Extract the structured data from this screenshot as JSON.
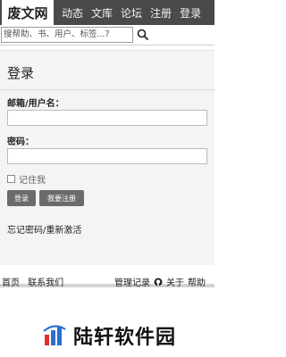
{
  "header": {
    "logo": "废文网",
    "nav": [
      "动态",
      "文库",
      "论坛",
      "注册",
      "登录"
    ]
  },
  "search": {
    "placeholder": "搜帮助、书、用户、标签...?"
  },
  "login": {
    "title": "登录",
    "username_label": "邮箱/用户名：",
    "password_label": "密码：",
    "remember_label": "记住我",
    "login_button": "登录",
    "register_button": "我要注册",
    "forgot_link": "忘记密码/重新激活"
  },
  "footer": {
    "left": [
      "首页",
      "联系我们"
    ],
    "manage": "管理记录",
    "about": "关于",
    "help": "帮助"
  },
  "watermark": {
    "text": "陆轩软件园"
  },
  "colors": {
    "topbar": "#4a4a4a",
    "panel": "#f4f4f4",
    "button": "#6b6b6b"
  }
}
